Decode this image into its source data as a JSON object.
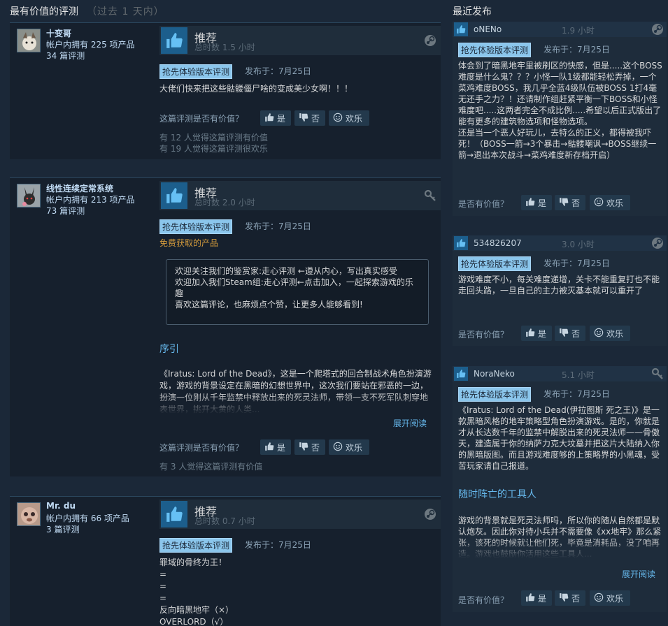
{
  "left_title": "最有价值的评测",
  "left_range": "（过去 1 天内）",
  "right_title": "最近发布",
  "common": {
    "recommended": "推荐",
    "early_access": "抢先体验版本评测",
    "helpful_question": "这篇评测是否有价值？",
    "yes": "是",
    "no": "否",
    "funny": "欢乐",
    "expand": "展开阅读",
    "right_helpful_question": "是否有价值？"
  },
  "reviews": [
    {
      "name": "十变哥",
      "products": "帐户内拥有 225 项产品",
      "review_count": "34 篇评测",
      "hours": "总时数 1.5 小时",
      "posted": "发布于：7月25日",
      "text": "大佬们快来把这些骷髅僵尸啥的变成美少女啊！！！",
      "helpful_count": "有 12 人觉得这篇评测有价值",
      "funny_count": "有 19 人觉得这篇评测很欢乐",
      "corner_icon": "steam-icon"
    },
    {
      "name": "线性连续定常系统",
      "products": "帐户内拥有 213 项产品",
      "review_count": "73 篇评测",
      "hours": "总时数 2.0 小时",
      "posted": "发布于：7月25日",
      "free_label": "免费获取的产品",
      "quote": "欢迎关注我们的鉴赏家:走心评测 ←遵从内心，写出真实感受\n欢迎加入我们Steam组:走心评测←点击加入，一起探索游戏的乐趣\n喜欢这篇评论，也麻烦点个赞，让更多人能够看到!",
      "heading": "序引",
      "text": "《Iratus: Lord of the Dead》，这是一个爬塔式的回合制战术角色扮演游戏，游戏的背景设定在黑暗的幻想世界中，这次我们要站在邪恶的一边，扮演一位刚从千年监禁中释放出来的死灵法师，带领一支不死军队刺穿地表世界，挑开大黄的人类...",
      "helpful_count": "有 3 人觉得这篇评测有价值",
      "corner_icon": "key-icon"
    },
    {
      "name": "Mr. du",
      "products": "帐户内拥有 66 项产品",
      "review_count": "3 篇评测",
      "hours": "总时数 0.7 小时",
      "posted": "发布于：7月25日",
      "text": "罪域的骨终为王！\n=\n=\n=\n反向暗黑地牢（×）\nOVERLORD（√）",
      "corner_icon": "steam-icon"
    }
  ],
  "recent": [
    {
      "name": "oNENo",
      "hours": "1.9 小时",
      "posted": "发布于：7月25日",
      "text": "体会到了暗黑地牢里被刷区的快感，但是.....这个BOSS难度是什么鬼？？？小怪一队1级都能轻松弄掉，一个菜鸡难度BOSS，我几乎全蓝4级队伍被BOSS 1打4毫无还手之力？！还请制作组赶紧平衡一下BOSS和小怪难度吧.....这两者完全不成比例.....希望以后正式版出了能有更多的建筑物选项和怪物选项。\n还是当一个恶人好玩儿，去特么的正义，都得被我吓死！（BOSS一箭→3个暴击→骷髅嘲讽→BOSS继续一箭→退出本次战斗→菜鸡难度新存档开启）",
      "corner_icon": "steam-icon"
    },
    {
      "name": "534826207",
      "hours": "3.0 小时",
      "posted": "发布于：7月25日",
      "text": "游戏难度不小，每关难度递增，关卡不能重复打也不能走回头路，一旦自己的主力被灭基本就可以重开了",
      "corner_icon": "steam-icon"
    },
    {
      "name": "NoraNeko",
      "hours": "5.1 小时",
      "posted": "发布于：7月25日",
      "text": "《Iratus: Lord of the Dead(伊拉图斯 死之王)》是一款黑暗风格的地牢策略型角色扮演游戏。是的，你就是才从长达数千年的监禁中解脱出来的死灵法师——骨傲天，建造属于你的纳萨力克大坟墓并把这片大陆纳入你的黑暗版图。而且游戏难度够的上策略界的小黑魂，受苦玩家请自己报道。",
      "heading": "随时阵亡的工具人",
      "text2": "游戏的背景就是死灵法师吗，所以你的随从自然都是默认炮灰。因此你对待小兵并不需要像《xx地牢》那么紧张，该死的时候就让他们死，毕竟是消耗品，没了咱再造。游戏也鼓励你活用这些工具人...",
      "corner_icon": "key-icon"
    }
  ]
}
